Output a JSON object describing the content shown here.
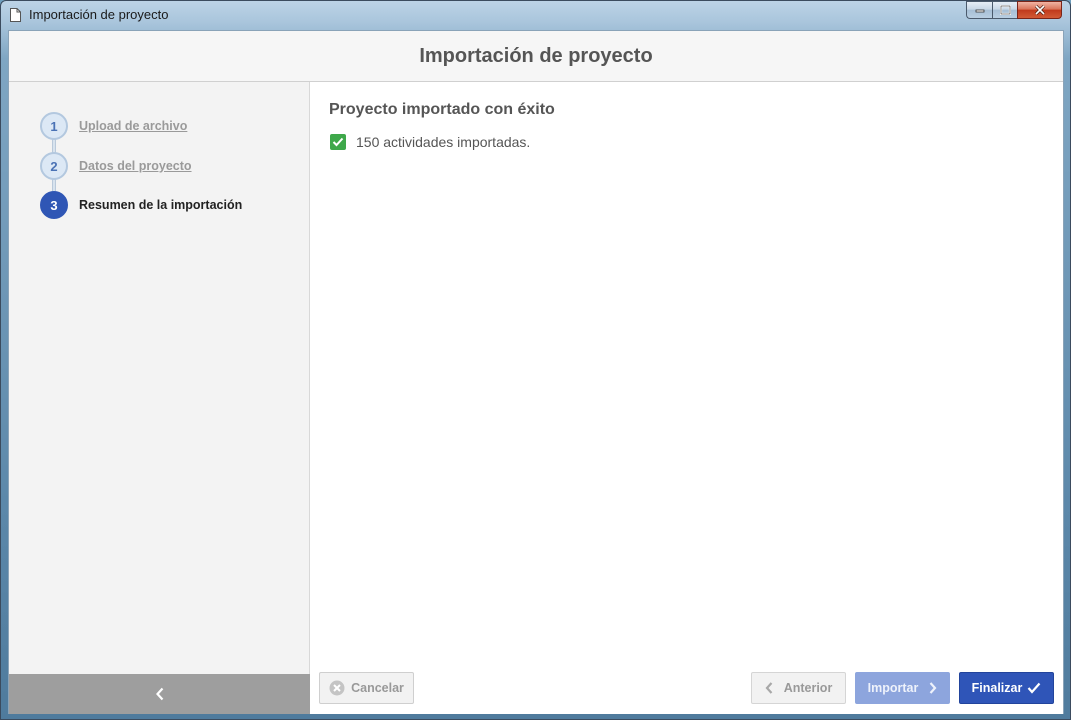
{
  "window": {
    "title": "Importación de proyecto",
    "icons": {
      "app": "document-icon",
      "minimize": "minimize-icon",
      "maximize": "maximize-icon",
      "close": "close-icon"
    }
  },
  "header": {
    "title": "Importación de proyecto"
  },
  "steps": [
    {
      "number": "1",
      "label": "Upload de archivo",
      "state": "completed"
    },
    {
      "number": "2",
      "label": "Datos del proyecto",
      "state": "completed"
    },
    {
      "number": "3",
      "label": "Resumen de la importación",
      "state": "active"
    }
  ],
  "main": {
    "result_title": "Proyecto importado con éxito",
    "result_text": "150 actividades importadas.",
    "result_checked": true
  },
  "sidebar": {
    "collapse_icon": "chevron-left-icon"
  },
  "footer": {
    "cancel_label": "Cancelar",
    "previous_label": "Anterior",
    "import_label": "Importar",
    "finish_label": "Finalizar"
  },
  "colors": {
    "accent": "#2f55b8",
    "accent_disabled": "#8da5dd",
    "success": "#3ea84a",
    "sidebar_bg": "#f3f3f3",
    "collapse_bar": "#9e9e9e"
  }
}
